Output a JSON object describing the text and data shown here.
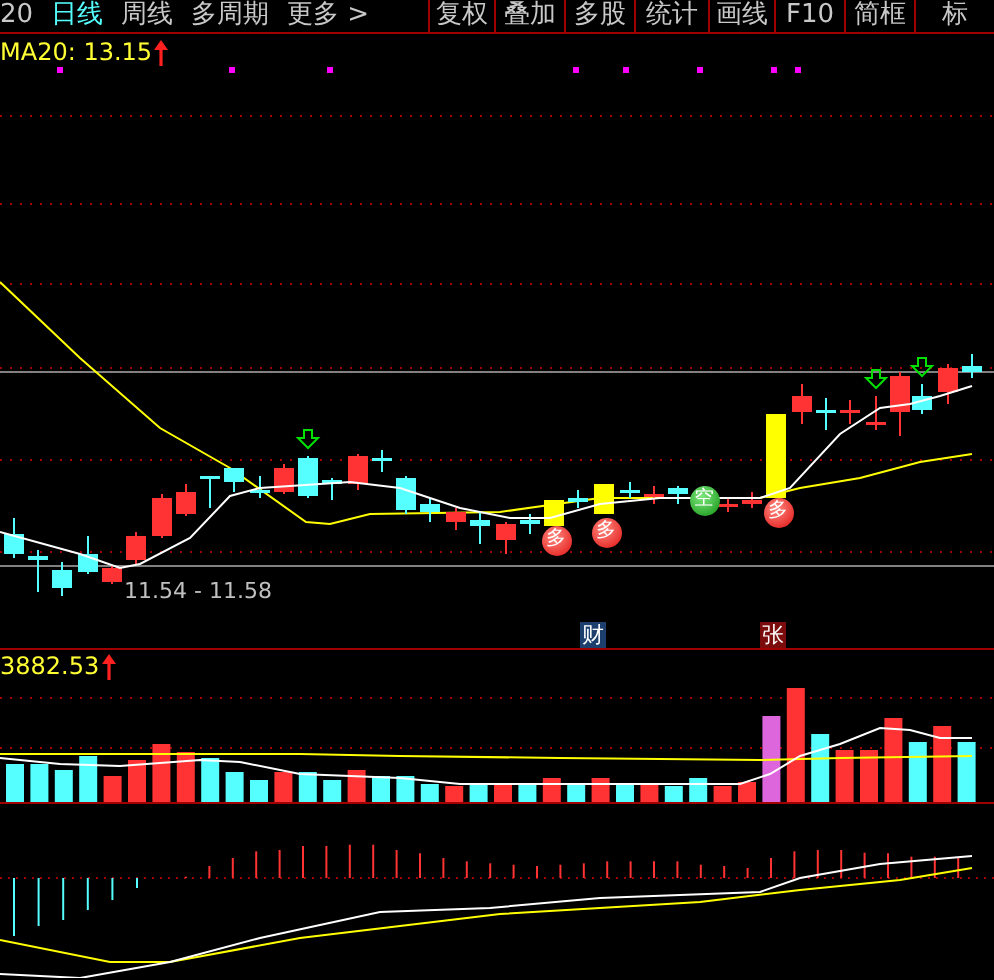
{
  "toolbar": {
    "period_tabs": [
      {
        "label": "20",
        "selected": false
      },
      {
        "label": "日线",
        "selected": true
      },
      {
        "label": "周线",
        "selected": false
      },
      {
        "label": "多周期",
        "selected": false
      },
      {
        "label": "更多 >",
        "selected": false
      }
    ],
    "tools": [
      "复权",
      "叠加",
      "多股",
      "统计",
      "画线",
      "F10",
      "简框",
      "标"
    ]
  },
  "price_panel": {
    "indicator": "MA20: 13.15",
    "range_label": "11.54 - 11.58",
    "signals": [
      {
        "label": "多",
        "kind": "buy"
      },
      {
        "label": "多",
        "kind": "buy"
      },
      {
        "label": "空",
        "kind": "sell"
      },
      {
        "label": "多",
        "kind": "buy"
      }
    ],
    "events": [
      {
        "label": "财",
        "color": "#1c3f6e"
      },
      {
        "label": "张",
        "color": "#7a0c0c"
      }
    ]
  },
  "volume_panel": {
    "reading": "3882.53"
  }
}
